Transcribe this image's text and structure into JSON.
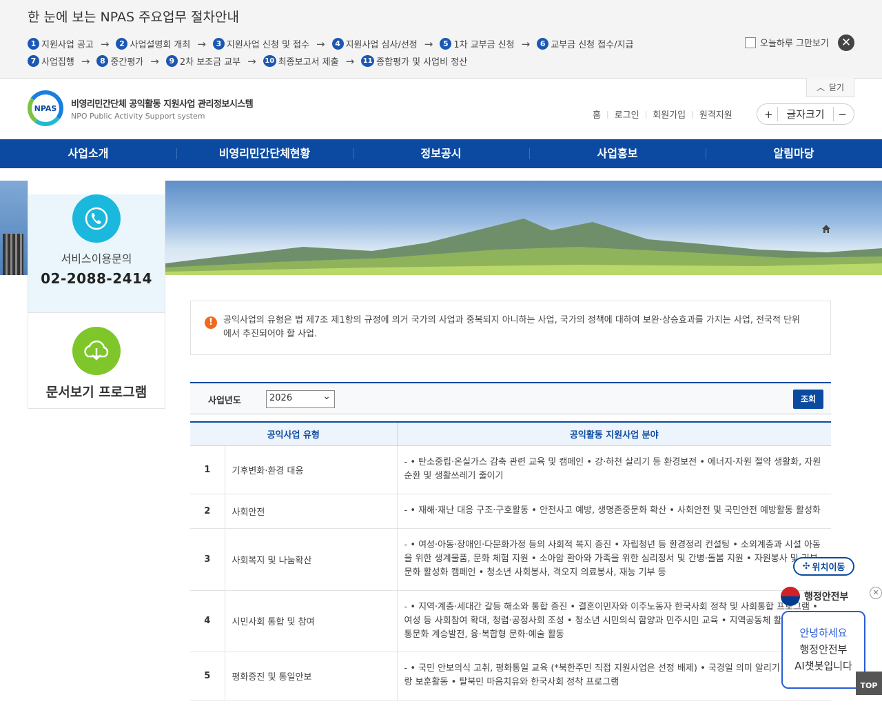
{
  "guide": {
    "title": "한 눈에 보는 NPAS 주요업무 절차안내",
    "steps_row1": [
      {
        "n": "1",
        "label": "지원사업 공고"
      },
      {
        "n": "2",
        "label": "사업설명회 개최"
      },
      {
        "n": "3",
        "label": "지원사업 신청 및 접수"
      },
      {
        "n": "4",
        "label": "지원사업 심사/선정"
      },
      {
        "n": "5",
        "label": "1차 교부금 신청"
      },
      {
        "n": "6",
        "label": "교부금 신청 접수/지급"
      }
    ],
    "steps_row2": [
      {
        "n": "7",
        "label": "사업집행"
      },
      {
        "n": "8",
        "label": "중간평가"
      },
      {
        "n": "9",
        "label": "2차 보조금 교부"
      },
      {
        "n": "10",
        "label": "최종보고서 제출"
      },
      {
        "n": "11",
        "label": "종합평가 및 사업비 정산"
      }
    ],
    "arrow": "→",
    "skip_today": "오늘하루 그만보기",
    "close_tab": "닫기"
  },
  "header": {
    "logo_badge": "NPAS",
    "logo_kr": "비영리민간단체 공익활동 지원사업 관리정보시스템",
    "logo_en": "NPO Public Activity Support system",
    "util_links": [
      "홈",
      "로그인",
      "회원가입",
      "원격지원"
    ],
    "font_size_label": "글자크기",
    "font_plus": "+",
    "font_minus": "−"
  },
  "nav": {
    "items": [
      "사업소개",
      "비영리민간단체현황",
      "정보공시",
      "사업홍보",
      "알림마당"
    ]
  },
  "side": {
    "service_label": "서비스이용문의",
    "phone": "02-2088-2414",
    "doc_viewer": "문서보기 프로그램"
  },
  "notice": {
    "icon": "!",
    "text": "공익사업의 유형은 법 제7조 제1항의 규정에 의거 국가의 사업과 중복되지 아니하는 사업, 국가의 정책에 대하여 보완·상승효과를 가지는 사업, 전국적 단위에서 추진되어야 할 사업."
  },
  "search": {
    "label": "사업년도",
    "year": "2026",
    "button": "조회"
  },
  "table": {
    "headers": [
      "공익사업 유형",
      "공익활동 지원사업 분야"
    ],
    "rows": [
      {
        "no": "1",
        "type": "기후변화·환경 대응",
        "area": "- • 탄소중립·온실가스 감축 관련 교육 및 캠페인 • 강·하천 살리기 등 환경보전 • 에너지·자원 절약 생활화, 자원순환 및 생활쓰레기 줄이기"
      },
      {
        "no": "2",
        "type": "사회안전",
        "area": "- • 재해·재난 대응 구조·구호활동 • 안전사고 예방, 생명존중문화 확산 • 사회안전 및 국민안전 예방활동 활성화"
      },
      {
        "no": "3",
        "type": "사회복지 및 나눔확산",
        "area": "- • 여성·아동·장애인·다문화가정 등의 사회적 복지 증진 • 자립청년 등 환경정리 컨설팅 • 소외계층과 시설 아동을 위한 생계물품, 문화 체험 지원 • 소아암 환아와 가족을 위한 심리정서 및 간병·돌봄 지원 • 자원봉사 및 기부문화 활성화 캠페인 • 청소년 사회봉사, 격오지 의료봉사, 재능 기부 등"
      },
      {
        "no": "4",
        "type": "시민사회 통합 및 참여",
        "area": "- • 지역·계층·세대간 갈등 해소와 통합 증진 • 결혼이민자와 이주노동자 한국사회 정착 및 사회통합 프로그램 • 여성 등 사회참여 확대, 청렴·공정사회 조성 • 청소년 시민의식 함양과 민주시민 교육 • 지역공동체 활성화 • 전통문화 계승발전, 융·복합형 문화·예술 활동"
      },
      {
        "no": "5",
        "type": "평화증진 및 통일안보",
        "area": "- • 국민 안보의식 고취, 평화통일 교육 (*북한주민 직접 지원사업은 선정 배제) • 국경일 의미 알리기 등 나라사랑 보훈활동 • 탈북민 마음치유와 한국사회 정착 프로그램"
      }
    ]
  },
  "floating": {
    "locate": "위치이동",
    "ministry": "행정안전부",
    "chat_line1": "안녕하세요",
    "chat_line2": "행정안전부",
    "chat_line3": "AI챗봇입니다",
    "chat_close": "✕",
    "top": "TOP"
  },
  "colors": {
    "primary": "#0b4aa0",
    "notice_icon": "#f06a1d",
    "phone_icon": "#1ab8dc",
    "doc_icon": "#7fc62b",
    "chat_border": "#2a5bd7"
  }
}
